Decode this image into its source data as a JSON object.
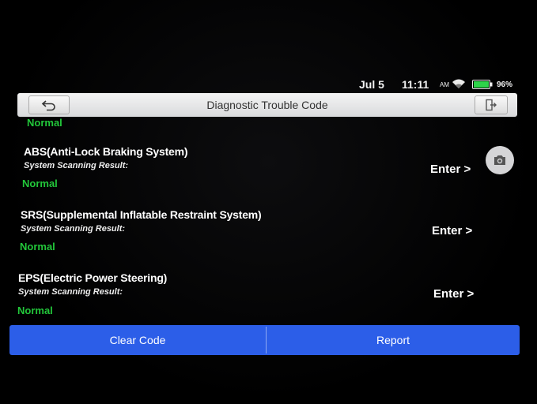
{
  "status": {
    "date": "Jul 5",
    "time": "11:11",
    "ampm": "AM",
    "battery": "96%"
  },
  "header": {
    "title": "Diagnostic Trouble Code"
  },
  "list": {
    "partial_status": "Normal",
    "items": [
      {
        "title": "ABS(Anti-Lock Braking System)",
        "subtitle": "System Scanning Result:",
        "status": "Normal",
        "action": "Enter >"
      },
      {
        "title": "SRS(Supplemental Inflatable Restraint System)",
        "subtitle": "System Scanning Result:",
        "status": "Normal",
        "action": "Enter >"
      },
      {
        "title": "EPS(Electric Power Steering)",
        "subtitle": "System Scanning Result:",
        "status": "Normal",
        "action": "Enter >"
      }
    ]
  },
  "footer": {
    "clear_label": "Clear Code",
    "report_label": "Report"
  },
  "icons": {
    "back": "back-arrow-icon",
    "exit": "exit-icon",
    "camera": "camera-icon",
    "wifi": "wifi-icon",
    "battery": "battery-icon"
  },
  "colors": {
    "status_green": "#22c63a",
    "button_blue": "#2c5ee8"
  }
}
